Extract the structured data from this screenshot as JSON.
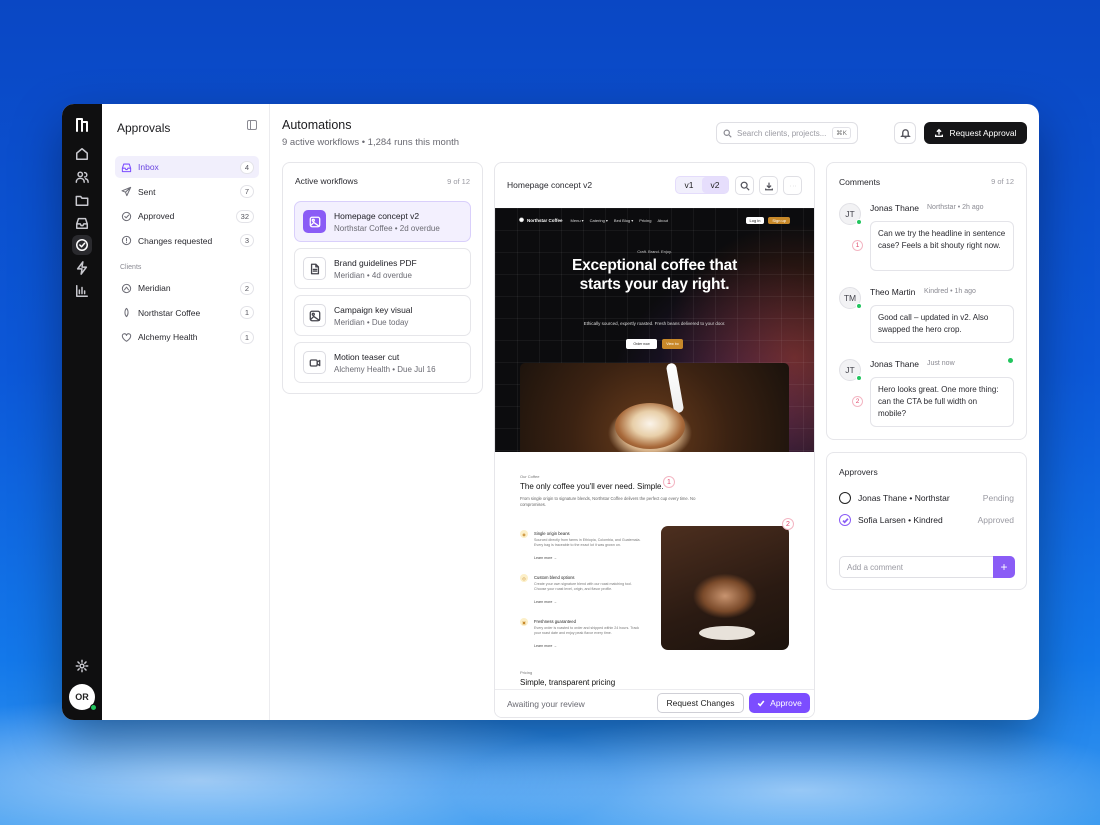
{
  "sidebar": {
    "title": "Approvals",
    "nav": [
      {
        "label": "Inbox",
        "count": "4",
        "icon": "inbox-icon"
      },
      {
        "label": "Sent",
        "count": "7",
        "icon": "send-icon"
      },
      {
        "label": "Approved",
        "count": "32",
        "icon": "check-circle-icon"
      },
      {
        "label": "Changes requested",
        "count": "3",
        "icon": "alert-circle-icon"
      }
    ],
    "clients_label": "Clients",
    "clients": [
      {
        "label": "Meridian",
        "count": "2"
      },
      {
        "label": "Northstar Coffee",
        "count": "1"
      },
      {
        "label": "Alchemy Health",
        "count": "1"
      }
    ]
  },
  "rail": {
    "avatar_initials": "OR"
  },
  "header": {
    "title": "Automations",
    "subtitle": "9 active workflows • 1,284 runs this month",
    "search_placeholder": "Search clients, projects...",
    "search_shortcut": "⌘K",
    "request_button": "Request Approval"
  },
  "workflows": {
    "title": "Active workflows",
    "meta": "9 of 12",
    "items": [
      {
        "title": "Homepage concept v2",
        "sub": "Northstar Coffee • 2d overdue",
        "icon": "image-icon"
      },
      {
        "title": "Brand guidelines PDF",
        "sub": "Meridian • 4d overdue",
        "icon": "document-icon"
      },
      {
        "title": "Campaign key visual",
        "sub": "Meridian • Due today",
        "icon": "image-icon"
      },
      {
        "title": "Motion teaser cut",
        "sub": "Alchemy Health • Due Jul 16",
        "icon": "video-icon"
      }
    ]
  },
  "preview": {
    "title": "Homepage concept v2",
    "version_a": "v1",
    "version_b": "v2",
    "status": "Awaiting your review",
    "request_changes": "Request Changes",
    "approve": "Approve",
    "site": {
      "brand": "Northstar Coffee",
      "nav": [
        "Menu ▾",
        "Catering ▾",
        "Bed Blog ▾",
        "Pricing",
        "About"
      ],
      "login": "Log in",
      "signup": "Sign up",
      "kicker": "Craft. Brand. Enjoy.",
      "headline": "Exceptional coffee that starts your day right.",
      "hero_sub": "Ethically sourced, expertly roasted. Fresh beans delivered to your door.",
      "cta_primary": "Order now",
      "cta_secondary": "View bo",
      "section_kicker": "Our Coffee",
      "section_title": "The only coffee you'll ever need. Simple.",
      "section_text": "From single origin to signature blends, Northstar Coffee delivers the perfect cup every time. No compromises.",
      "features": [
        {
          "title": "Single origin beans",
          "text": "Sourced directly from farms in Ethiopia, Colombia, and Guatemala. Every bag is traceable to the exact lot it was grown on.",
          "link": "Learn more →"
        },
        {
          "title": "Custom blend options",
          "text": "Create your own signature blend with our roast matching tool. Choose your roast level, origin, and flavor profile.",
          "link": "Learn more →"
        },
        {
          "title": "Freshness guaranteed",
          "text": "Every order is roasted to order and shipped within 24 hours. Track your roast date and enjoy peak flavor every time.",
          "link": "Learn more →"
        }
      ],
      "pricing_kicker": "Pricing",
      "pricing_title": "Simple, transparent pricing",
      "pin1": "1",
      "pin2": "2"
    }
  },
  "comments": {
    "title": "Comments",
    "meta": "9 of 12",
    "items": [
      {
        "initials": "JT",
        "name": "Jonas Thane",
        "meta": "Northstar • 2h ago",
        "pin": "1",
        "text": "Can we try the headline in sentence case? Feels a bit shouty right now."
      },
      {
        "initials": "TM",
        "name": "Theo Martin",
        "meta": "Kindred • 1h ago",
        "pin": "",
        "text": "Good call – updated in v2. Also swapped the hero crop."
      },
      {
        "initials": "JT",
        "name": "Jonas Thane",
        "meta": "Just now",
        "pin": "2",
        "text": "Hero looks great. One more thing: can the CTA be full width on mobile?"
      }
    ]
  },
  "approvers": {
    "title": "Approvers",
    "items": [
      {
        "name": "Jonas Thane • Northstar",
        "status": "Pending"
      },
      {
        "name": "Sofia Larsen • Kindred",
        "status": "Approved"
      }
    ],
    "comment_placeholder": "Add a comment"
  },
  "colors": {
    "accent": "#7c4dff",
    "rail": "#0f0f10",
    "online": "#22c55e"
  }
}
